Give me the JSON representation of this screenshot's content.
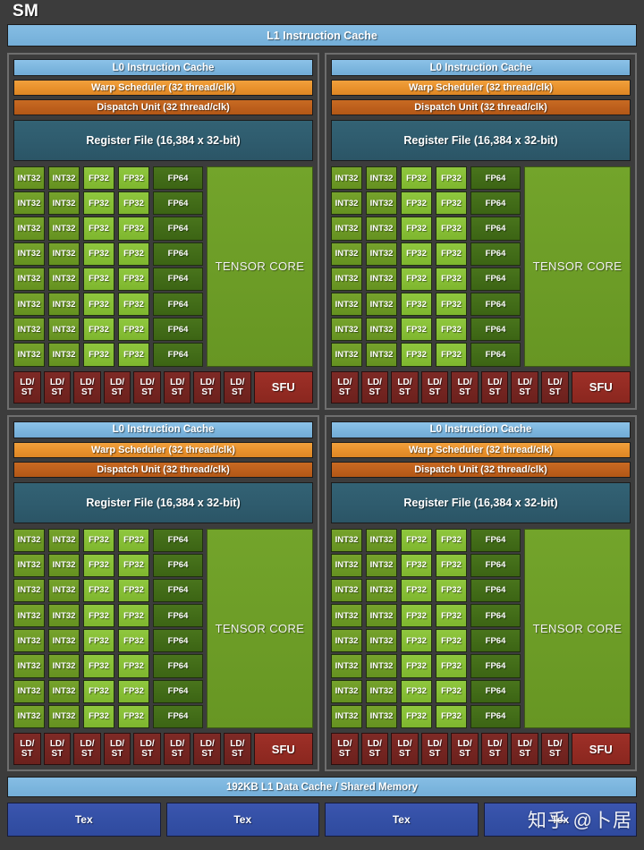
{
  "diagram": {
    "title": "SM",
    "l1_instruction_cache": "L1 Instruction Cache",
    "l1_data_cache": "192KB L1 Data Cache / Shared Memory",
    "block": {
      "l0_instruction_cache": "L0 Instruction Cache",
      "warp_scheduler": "Warp Scheduler (32 thread/clk)",
      "dispatch_unit": "Dispatch Unit (32 thread/clk)",
      "register_file": "Register File (16,384 x 32-bit)",
      "tensor_core": "TENSOR CORE",
      "int32": "INT32",
      "fp32": "FP32",
      "fp64": "FP64",
      "ldst": "LD/\nST",
      "ldst_line1": "LD/",
      "ldst_line2": "ST",
      "sfu": "SFU",
      "core_rows": 8,
      "int32_per_row": 2,
      "fp32_per_row": 2,
      "fp64_per_row": 1,
      "ldst_count": 8,
      "sfu_count": 1
    },
    "processing_blocks": 4,
    "tex_units": [
      {
        "label": "Tex",
        "watermark": ""
      },
      {
        "label": "Tex",
        "watermark": ""
      },
      {
        "label": "Tex",
        "watermark": ""
      },
      {
        "label": "Tex",
        "watermark": "知乎 @卜居"
      }
    ],
    "colors": {
      "background": "#3c3c3c",
      "cache_blue": "#7cb6de",
      "warp_orange": "#e8912c",
      "dispatch_orange": "#bc5f1c",
      "register_teal": "#2f5c6e",
      "int32_green": "#6d9a26",
      "fp32_green": "#87bf36",
      "fp64_green": "#426c18",
      "tensor_green": "#6d9d27",
      "ldst_red": "#752521",
      "sfu_red": "#942b23",
      "tex_blue": "#3450a6"
    }
  }
}
